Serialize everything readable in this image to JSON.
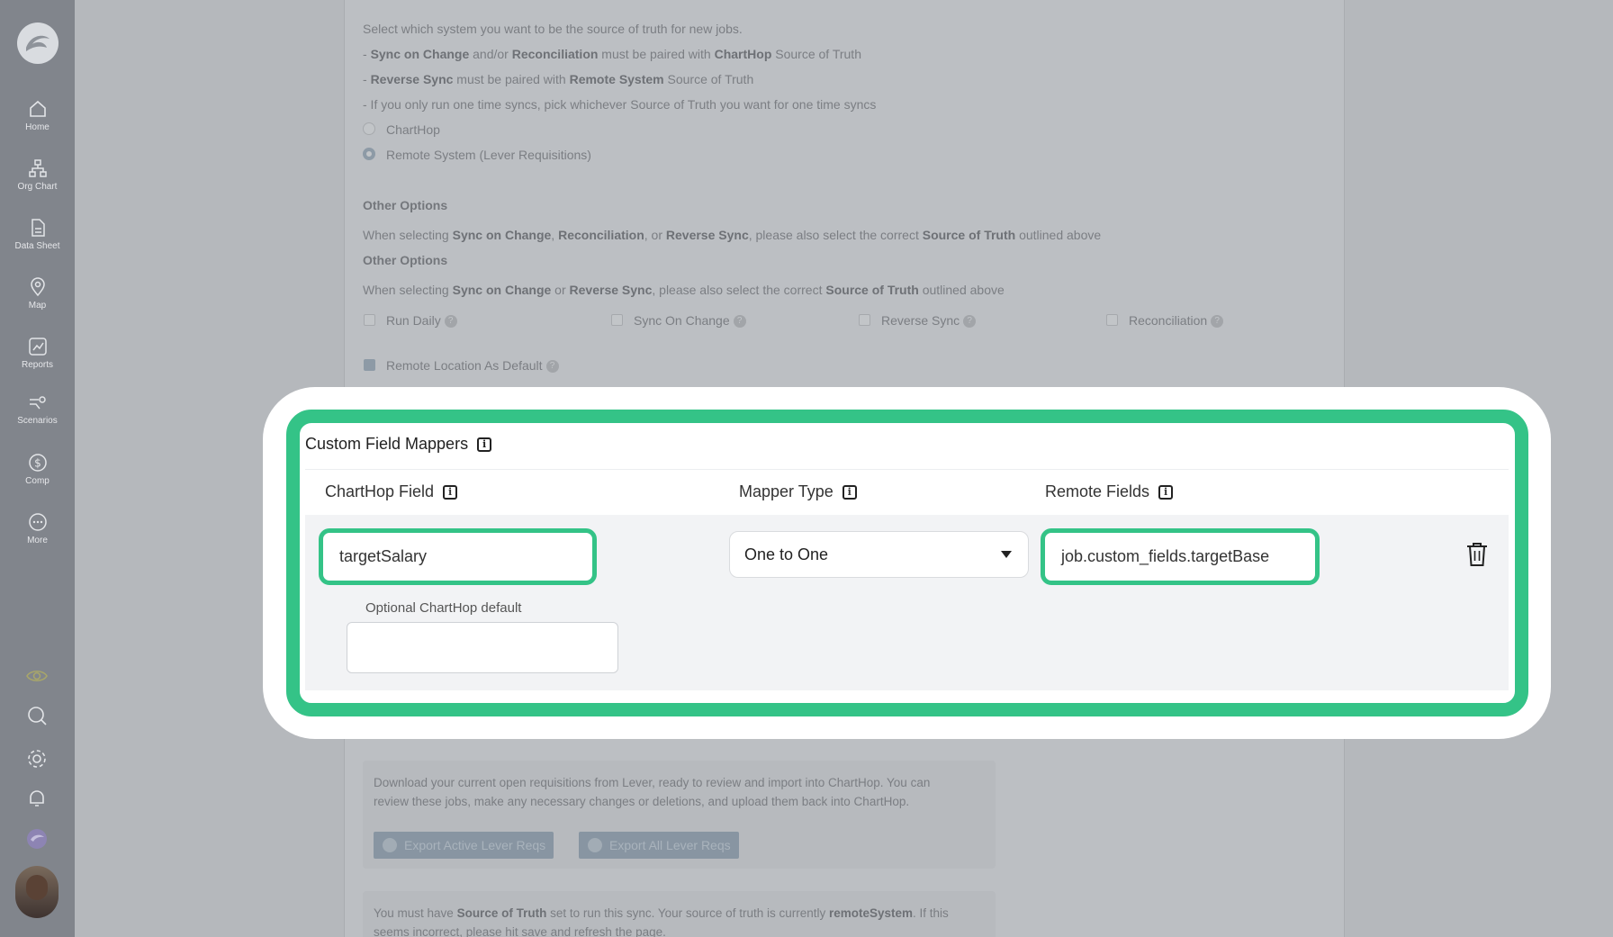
{
  "sidebar": {
    "items": [
      {
        "label": "Home",
        "icon": "home-icon"
      },
      {
        "label": "Org Chart",
        "icon": "org-chart-icon"
      },
      {
        "label": "Data Sheet",
        "icon": "data-sheet-icon"
      },
      {
        "label": "Map",
        "icon": "map-pin-icon"
      },
      {
        "label": "Reports",
        "icon": "reports-icon"
      },
      {
        "label": "Scenarios",
        "icon": "scenarios-icon"
      },
      {
        "label": "Comp",
        "icon": "dollar-icon"
      },
      {
        "label": "More",
        "icon": "more-icon"
      }
    ],
    "bottom_icons": [
      "eye-icon",
      "search-icon",
      "gear-icon",
      "bell-icon",
      "app-logo-icon"
    ]
  },
  "source_of_truth": {
    "description": "Select which system you want to be the source of truth for new jobs.",
    "rule1_pre": "- ",
    "rule1_b1": "Sync on Change",
    "rule1_mid1": " and/or ",
    "rule1_b2": "Reconciliation",
    "rule1_mid2": " must be paired with ",
    "rule1_b3": "ChartHop",
    "rule1_post": " Source of Truth",
    "rule2_pre": "- ",
    "rule2_b1": "Reverse Sync",
    "rule2_mid": " must be paired with ",
    "rule2_b2": "Remote System",
    "rule2_post": " Source of Truth",
    "rule3": "- If you only run one time syncs, pick whichever Source of Truth you want for one time syncs",
    "options": [
      "ChartHop",
      "Remote System (Lever Requisitions)"
    ],
    "selected": "Remote System (Lever Requisitions)"
  },
  "other_options": {
    "heading1": "Other Options",
    "note1_pre": "When selecting ",
    "note1_b1": "Sync on Change",
    "note1_c1": ", ",
    "note1_b2": "Reconciliation",
    "note1_c2": ", or ",
    "note1_b3": "Reverse Sync",
    "note1_c3": ", please also select the correct ",
    "note1_b4": "Source of Truth",
    "note1_post": " outlined above",
    "heading2": "Other Options",
    "note2_pre": "When selecting ",
    "note2_b1": "Sync on Change",
    "note2_c1": " or ",
    "note2_b2": "Reverse Sync",
    "note2_c2": ", please also select the correct ",
    "note2_b3": "Source of Truth",
    "note2_post": " outlined above",
    "checkboxes": [
      {
        "label": "Run Daily",
        "checked": false
      },
      {
        "label": "Sync On Change",
        "checked": false
      },
      {
        "label": "Reverse Sync",
        "checked": false
      },
      {
        "label": "Reconciliation",
        "checked": false
      }
    ],
    "remote_location_default": {
      "label": "Remote Location As Default",
      "checked": true
    }
  },
  "custom_field_mappers": {
    "title": "Custom Field Mappers",
    "columns": [
      "ChartHop Field",
      "Mapper Type",
      "Remote Fields"
    ],
    "row": {
      "charthop_field": "targetSalary",
      "mapper_type": "One to One",
      "remote_field": "job.custom_fields.targetBase",
      "optional_default_label": "Optional ChartHop default",
      "optional_default_value": ""
    }
  },
  "export": {
    "description_line1": "Download your current open requisitions from Lever, ready to review and import into ChartHop. You can",
    "description_line2": "review these jobs, make any necessary changes or deletions, and upload them back into ChartHop.",
    "button_active": "Export Active Lever Reqs",
    "button_all": "Export All Lever Reqs"
  },
  "sync_note": {
    "pre": "You must have ",
    "b1": "Source of Truth",
    "mid": " set to run this sync. Your source of truth is currently ",
    "b2": "remoteSystem",
    "post": ". If this",
    "line2": "seems incorrect, please hit save and refresh the page."
  },
  "colors": {
    "highlight_green": "#34c387",
    "sidebar": "#81858c"
  }
}
